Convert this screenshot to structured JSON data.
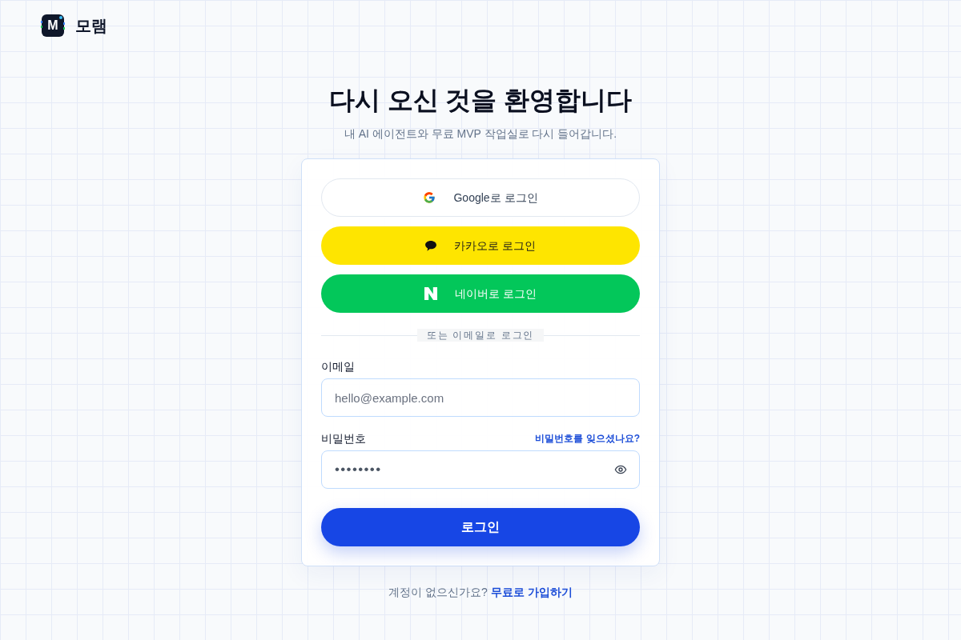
{
  "brand": {
    "logo_letter": "M",
    "name": "모램"
  },
  "heading": {
    "title": "다시 오신 것을 환영합니다",
    "subtitle": "내 AI 에이전트와 무료 MVP 작업실로 다시 들어갑니다."
  },
  "social_buttons": [
    {
      "kind": "google",
      "label": "Google로 로그인"
    },
    {
      "kind": "kakao",
      "label": "카카오로 로그인"
    },
    {
      "kind": "naver",
      "label": "네이버로 로그인"
    }
  ],
  "divider": "또는 이메일로 로그인",
  "email": {
    "label": "이메일",
    "placeholder": "hello@example.com"
  },
  "password": {
    "label": "비밀번호",
    "placeholder": "••••••••",
    "forgot_link": "비밀번호를 잊으셨나요?"
  },
  "submit": "로그인",
  "footer": {
    "prompt": "계정이 없으신가요?",
    "link": "무료로 가입하기"
  }
}
